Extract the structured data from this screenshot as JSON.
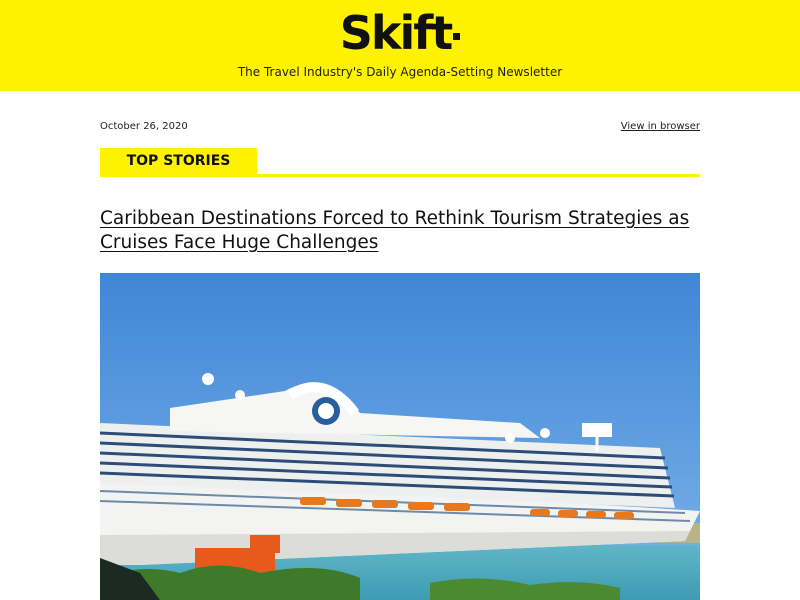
{
  "header": {
    "logo_text": "Skift",
    "tagline": "The Travel Industry's Daily Agenda-Setting Newsletter",
    "background_color": "#fff200"
  },
  "meta": {
    "date": "October 26, 2020",
    "view_in_browser": "View in browser"
  },
  "section": {
    "label": "TOP STORIES",
    "accent_color": "#fff200"
  },
  "story": {
    "headline": "Caribbean Destinations Forced to Rethink Tourism Strategies as Cruises Face Huge Challenges",
    "image_subject": "cruise-ship-photo"
  }
}
